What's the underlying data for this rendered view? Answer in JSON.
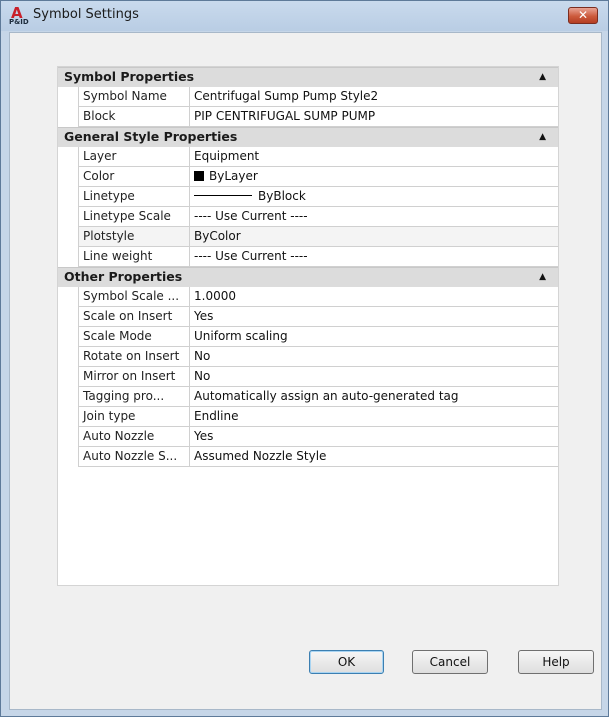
{
  "window": {
    "title": "Symbol Settings",
    "app_icon_letter": "A",
    "app_icon_sub": "P&ID",
    "close_glyph": "✕"
  },
  "sections": [
    {
      "title": "Symbol Properties",
      "rows": [
        {
          "name": "Symbol Name",
          "value": "Centrifugal Sump Pump Style2"
        },
        {
          "name": "Block",
          "value": "PIP CENTRIFUGAL SUMP PUMP"
        }
      ]
    },
    {
      "title": "General Style Properties",
      "rows": [
        {
          "name": "Layer",
          "value": "Equipment"
        },
        {
          "name": "Color",
          "value": "ByLayer",
          "swatch_color": "#000000"
        },
        {
          "name": "Linetype",
          "value": "ByBlock"
        },
        {
          "name": "Linetype Scale",
          "value": "---- Use Current ----"
        },
        {
          "name": "Plotstyle",
          "value": "ByColor"
        },
        {
          "name": "Line weight",
          "value": "---- Use Current ----"
        }
      ]
    },
    {
      "title": "Other Properties",
      "rows": [
        {
          "name": "Symbol Scale ...",
          "value": "1.0000"
        },
        {
          "name": "Scale on Insert",
          "value": "Yes"
        },
        {
          "name": "Scale Mode",
          "value": "Uniform scaling"
        },
        {
          "name": "Rotate on Insert",
          "value": "No"
        },
        {
          "name": "Mirror on Insert",
          "value": "No"
        },
        {
          "name": "Tagging pro...",
          "value": "Automatically assign an auto-generated tag"
        },
        {
          "name": "Join type",
          "value": "Endline"
        },
        {
          "name": "Auto Nozzle",
          "value": "Yes"
        },
        {
          "name": "Auto Nozzle S...",
          "value": "Assumed Nozzle Style"
        }
      ]
    }
  ],
  "buttons": {
    "ok": "OK",
    "cancel": "Cancel",
    "help": "Help"
  },
  "icons": {
    "collapse": "▲"
  }
}
